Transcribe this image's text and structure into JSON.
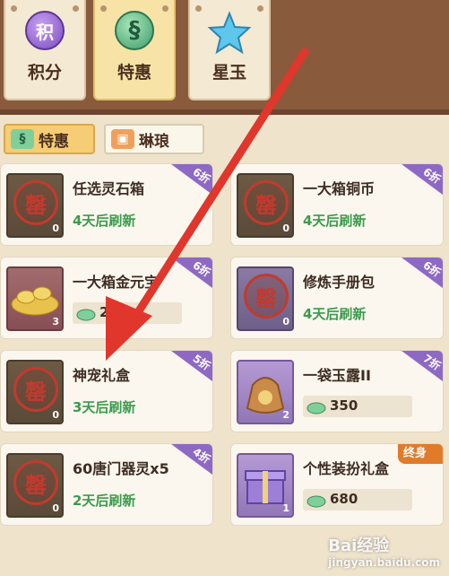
{
  "main_tabs": [
    {
      "label": "积分",
      "icon": "points-coin-icon",
      "icon_char": "积"
    },
    {
      "label": "特惠",
      "icon": "dragon-badge-icon",
      "icon_char": "§"
    },
    {
      "label": "星玉",
      "icon": "star-jade-icon"
    }
  ],
  "sub_tabs": [
    {
      "label": "特惠",
      "icon": "dragon-small-icon"
    },
    {
      "label": "琳琅",
      "icon": "card-icon"
    }
  ],
  "cards": [
    {
      "title": "任选灵石箱",
      "refresh": "4天后刷新",
      "badge": "6折",
      "count": "0"
    },
    {
      "title": "一大箱铜币",
      "refresh": "4天后刷新",
      "badge": "6折",
      "count": "0"
    },
    {
      "title": "一大箱金元宝",
      "price": "25",
      "badge": "6折",
      "count": "3"
    },
    {
      "title": "修炼手册包",
      "refresh": "4天后刷新",
      "badge": "6折",
      "count": "0"
    },
    {
      "title": "神宠礼盒",
      "refresh": "3天后刷新",
      "badge": "5折",
      "count": "0"
    },
    {
      "title": "一袋玉露II",
      "price": "350",
      "badge": "7折",
      "count": "2"
    },
    {
      "title": "60唐门器灵x5",
      "refresh": "2天后刷新",
      "badge": "4折",
      "count": "0"
    },
    {
      "title": "个性装扮礼盒",
      "price": "680",
      "badge": "终身",
      "count": "1"
    }
  ],
  "stamp_char": "罄",
  "watermark": {
    "line1": "Bai经验",
    "line2": "jingyan.baidu.com"
  },
  "colors": {
    "accent_green": "#3c9a4c",
    "badge_purple": "#8e69c4",
    "arrow_red": "#e0362b"
  }
}
